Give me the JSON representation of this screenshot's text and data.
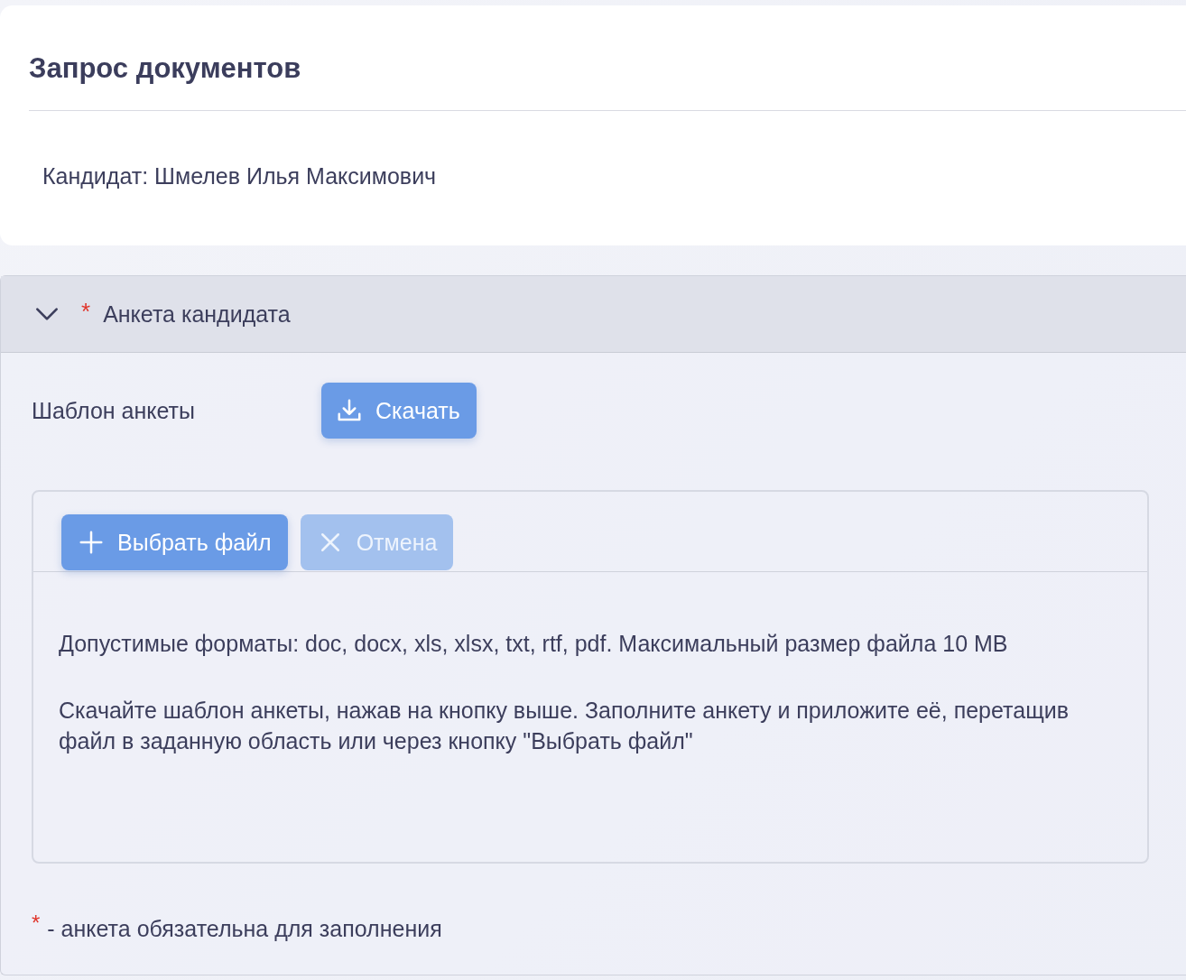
{
  "header": {
    "title": "Запрос документов",
    "candidate": "Кандидат: Шмелев Илья Максимович"
  },
  "section": {
    "title": "Анкета кандидата",
    "required": true,
    "expanded": true,
    "template_label": "Шаблон анкеты",
    "download_button": {
      "label": "Скачать",
      "disabled": false
    },
    "upload": {
      "select_button": {
        "label": "Выбрать файл",
        "disabled": false
      },
      "cancel_button": {
        "label": "Отмена",
        "disabled": true
      },
      "hints": [
        "Допустимые форматы: doc, docx, xls, xlsx, txt, rtf, pdf. Максимальный размер файла 10 MB",
        "Скачайте шаблон анкеты, нажав на кнопку выше. Заполните анкету и приложите её, перетащив файл в заданную область или через кнопку \"Выбрать файл\""
      ]
    },
    "footnote": {
      "mark": "*",
      "text": "- анкета обязательна для заполнения"
    }
  }
}
